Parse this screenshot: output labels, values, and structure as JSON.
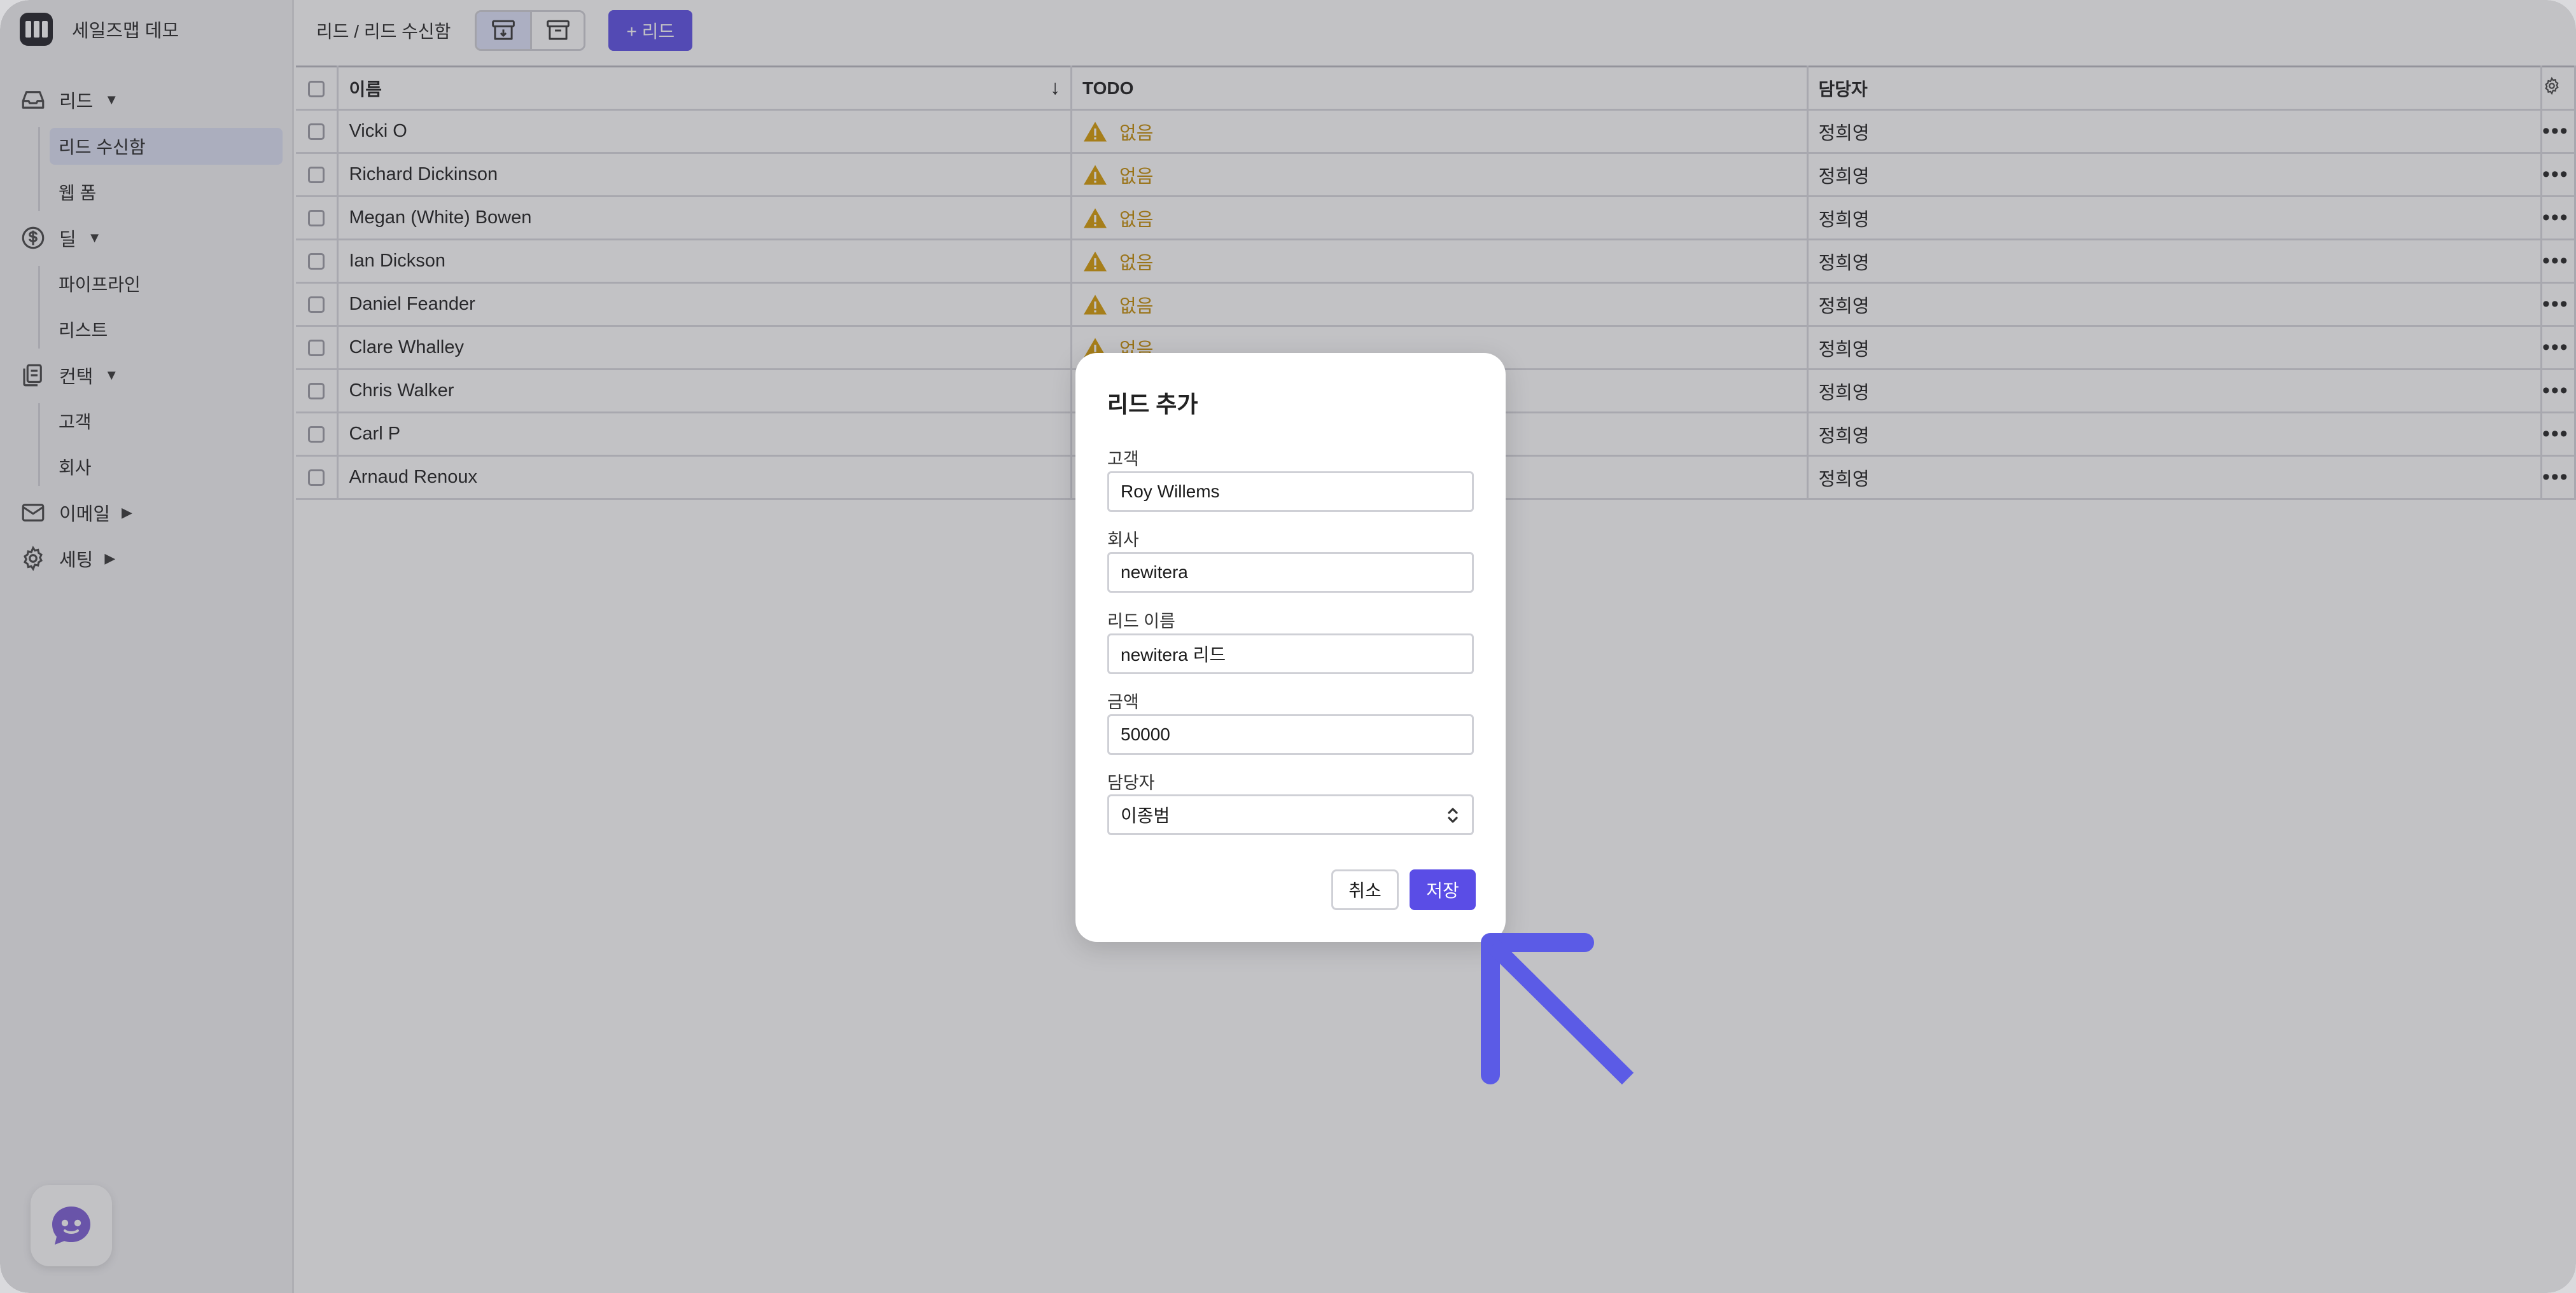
{
  "app": {
    "name": "세일즈맵 데모"
  },
  "sidebar": {
    "groups": [
      {
        "label": "리드",
        "caret": "▼",
        "items": [
          "리드 수신함",
          "웹 폼"
        ]
      },
      {
        "label": "딜",
        "caret": "▼",
        "items": [
          "파이프라인",
          "리스트"
        ]
      },
      {
        "label": "컨택",
        "caret": "▼",
        "items": [
          "고객",
          "회사"
        ]
      },
      {
        "label": "이메일",
        "caret": "▶",
        "items": []
      },
      {
        "label": "세팅",
        "caret": "▶",
        "items": []
      }
    ],
    "active_item": "리드 수신함"
  },
  "topbar": {
    "breadcrumb": "리드 / 리드 수신함",
    "add_button": "+ 리드"
  },
  "table": {
    "columns": [
      "이름",
      "TODO",
      "담당자"
    ],
    "rows": [
      {
        "name": "Vicki O",
        "todo": "없음",
        "owner": "정희영"
      },
      {
        "name": "Richard Dickinson",
        "todo": "없음",
        "owner": "정희영"
      },
      {
        "name": "Megan (White) Bowen",
        "todo": "없음",
        "owner": "정희영"
      },
      {
        "name": "Ian Dickson",
        "todo": "없음",
        "owner": "정희영"
      },
      {
        "name": "Daniel Feander",
        "todo": "없음",
        "owner": "정희영"
      },
      {
        "name": "Clare Whalley",
        "todo": "없음",
        "owner": "정희영"
      },
      {
        "name": "Chris Walker",
        "todo": "",
        "owner": "정희영"
      },
      {
        "name": "Carl P",
        "todo": "",
        "owner": "정희영"
      },
      {
        "name": "Arnaud Renoux",
        "todo": "",
        "owner": "정희영"
      }
    ]
  },
  "dialog": {
    "title": "리드 추가",
    "customer_label": "고객",
    "customer_value": "Roy Willems",
    "company_label": "회사",
    "company_value": "newitera",
    "lead_name_label": "리드 이름",
    "lead_name_value": "newitera 리드",
    "amount_label": "금액",
    "amount_value": "50000",
    "owner_label": "담당자",
    "owner_value": "이종범",
    "cancel_label": "취소",
    "save_label": "저장"
  },
  "colors": {
    "accent": "#5a4de6",
    "warning": "#c48b00",
    "arrow": "#5b5be6"
  }
}
